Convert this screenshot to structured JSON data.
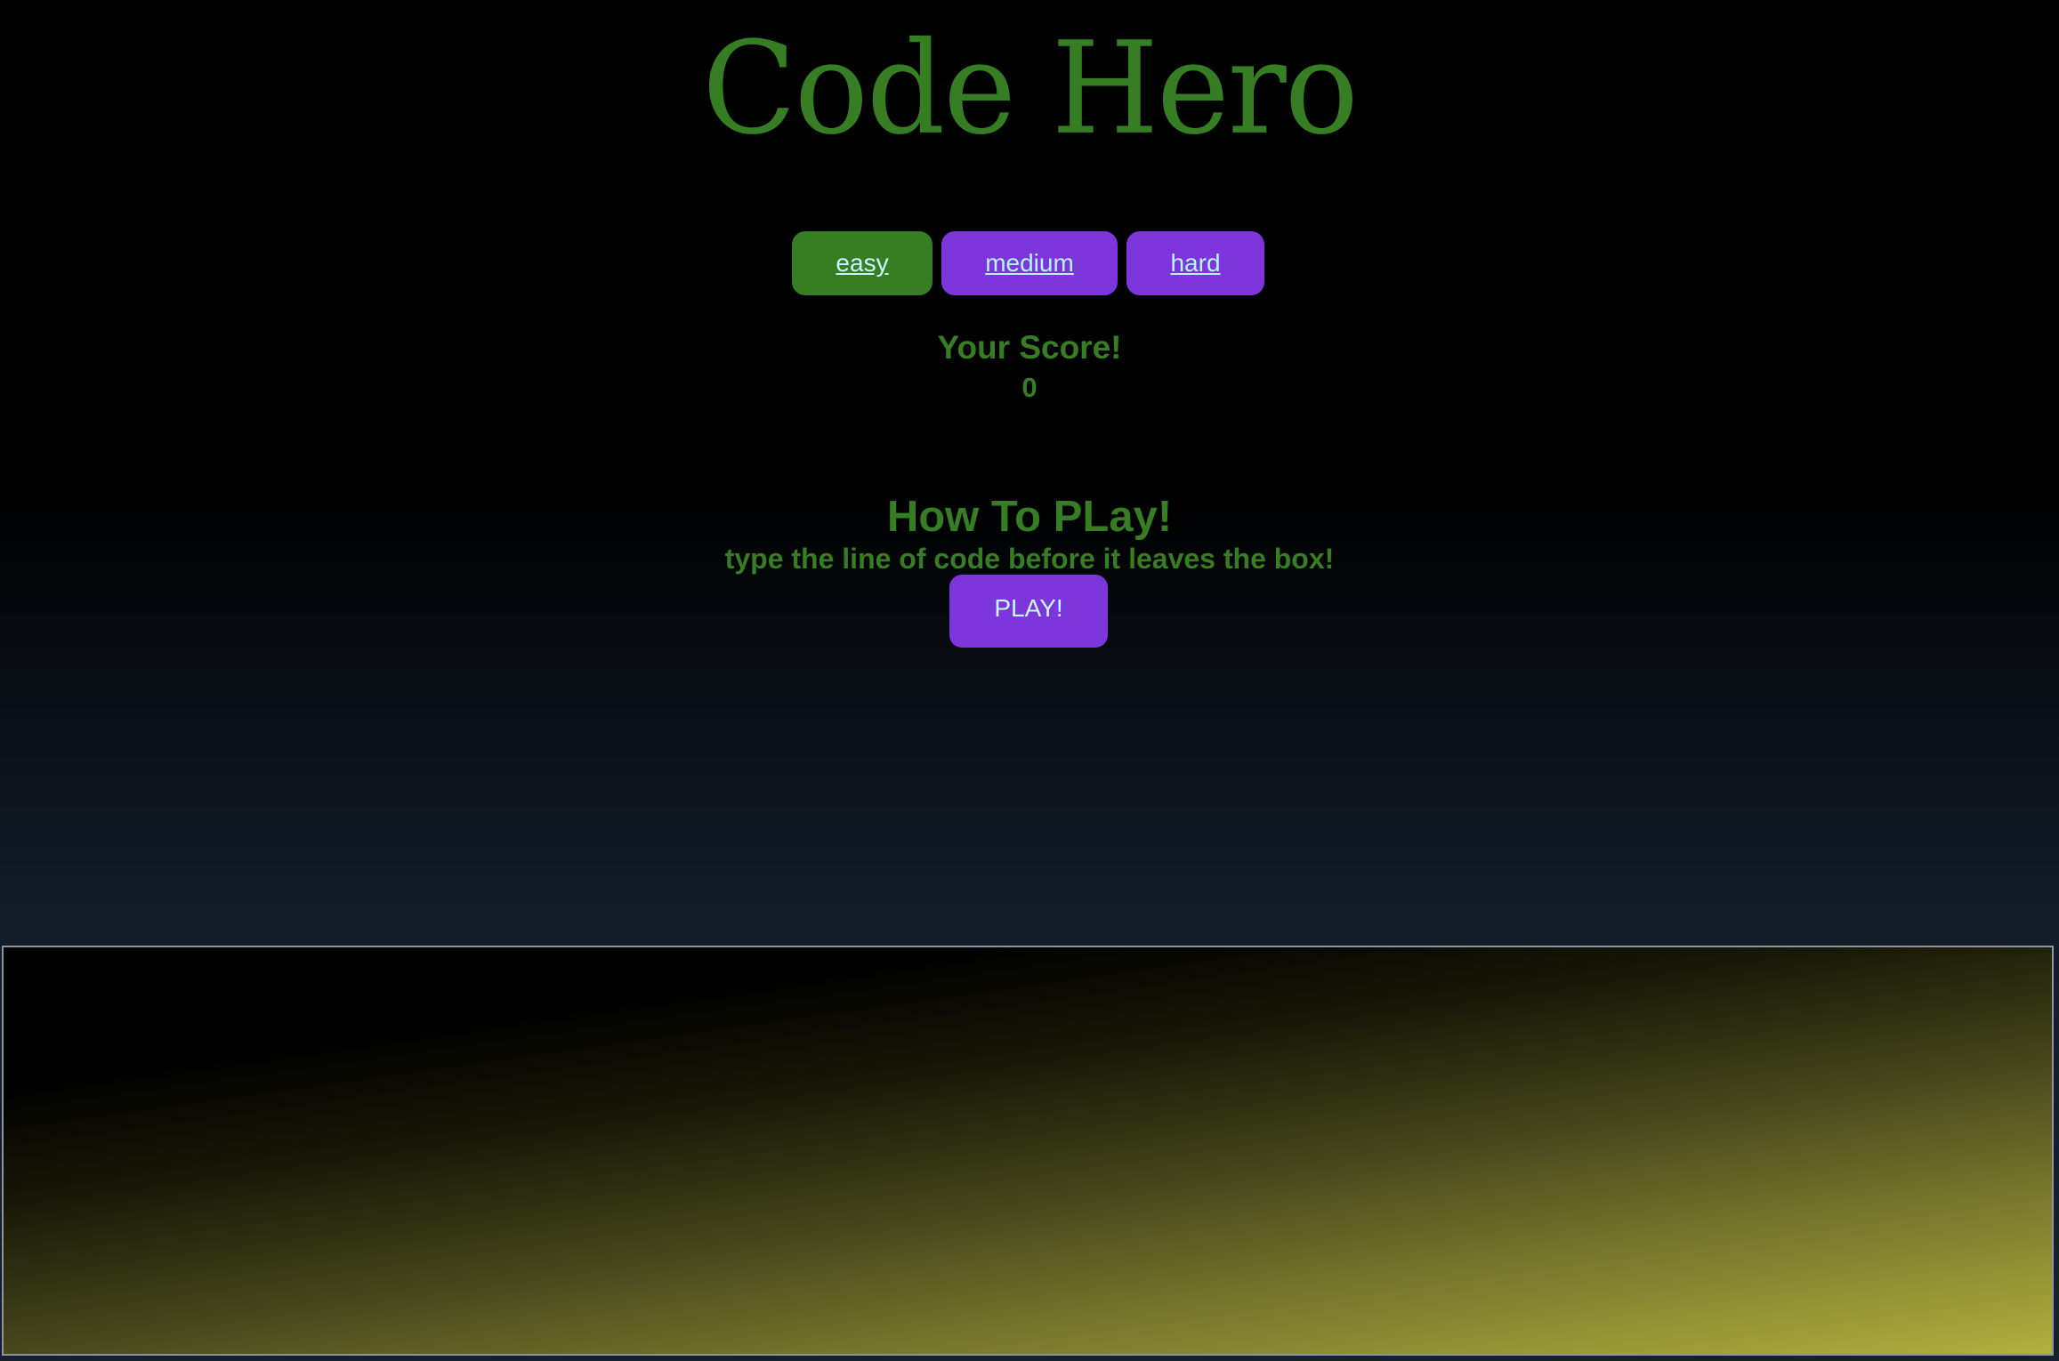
{
  "title": "Code Hero",
  "difficulty": {
    "options": [
      {
        "label": "easy",
        "selected": true
      },
      {
        "label": "medium",
        "selected": false
      },
      {
        "label": "hard",
        "selected": false
      }
    ]
  },
  "score": {
    "label": "Your Score!",
    "value": "0"
  },
  "instructions": {
    "title": "How To PLay!",
    "text": "type the line of code before it leaves the box!"
  },
  "play_button": {
    "label": "PLAY!"
  },
  "colors": {
    "title_green": "#367d23",
    "button_purple": "#7d36dc",
    "selected_green": "#367d23",
    "button_text": "#b6f4ff"
  }
}
